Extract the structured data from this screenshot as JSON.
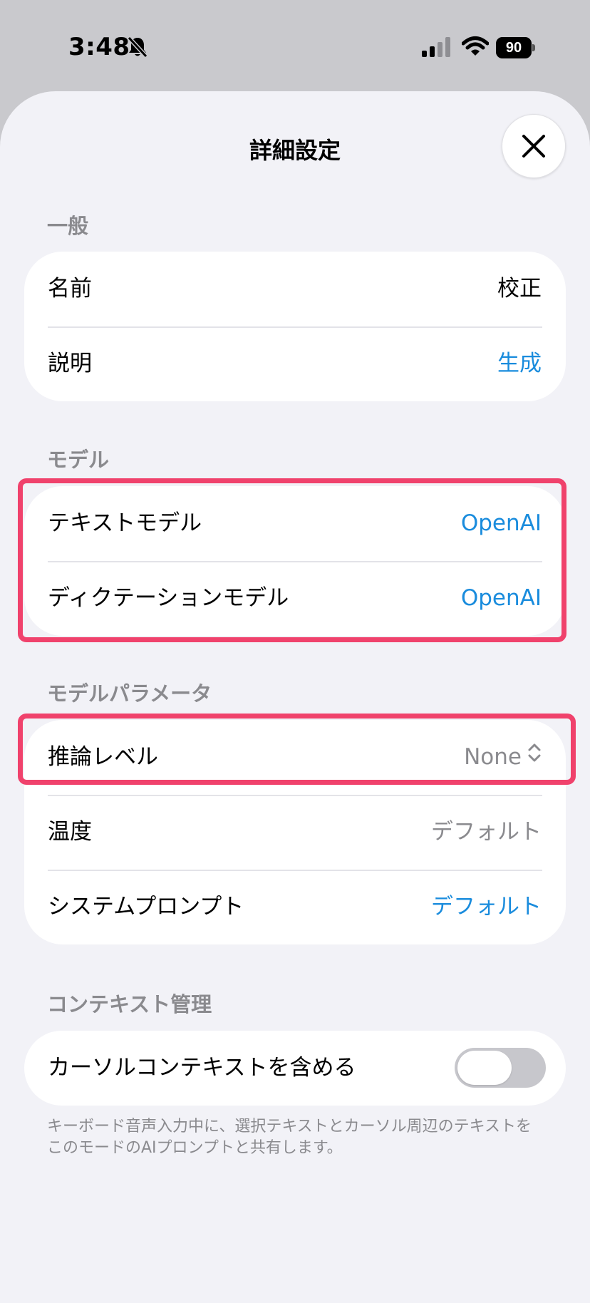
{
  "status_bar": {
    "time": "3:48",
    "bell_icon": "bell-slash-icon",
    "signal_icon": "cellular-signal-icon",
    "wifi_icon": "wifi-icon",
    "battery_level": "90"
  },
  "sheet": {
    "title": "詳細設定",
    "close_icon": "close-icon"
  },
  "sections": {
    "general": {
      "header": "一般",
      "rows": [
        {
          "label": "名前",
          "value": "校正"
        },
        {
          "label": "説明",
          "value": "生成"
        }
      ]
    },
    "model": {
      "header": "モデル",
      "rows": [
        {
          "label": "テキストモデル",
          "value": "OpenAI"
        },
        {
          "label": "ディクテーションモデル",
          "value": "OpenAI"
        }
      ]
    },
    "model_params": {
      "header": "モデルパラメータ",
      "rows": [
        {
          "label": "推論レベル",
          "value": "None"
        },
        {
          "label": "温度",
          "value": "デフォルト"
        },
        {
          "label": "システムプロンプト",
          "value": "デフォルト"
        }
      ]
    },
    "context": {
      "header": "コンテキスト管理",
      "rows": [
        {
          "label": "カーソルコンテキストを含める",
          "toggle_on": false
        }
      ],
      "footnote": "キーボード音声入力中に、選択テキストとカーソル周辺のテキストをこのモードのAIプロンプトと共有します。"
    }
  },
  "colors": {
    "accent_blue": "#1a8cdd",
    "highlight_red": "#f0426c",
    "secondary_gray": "#8a8a8e"
  }
}
